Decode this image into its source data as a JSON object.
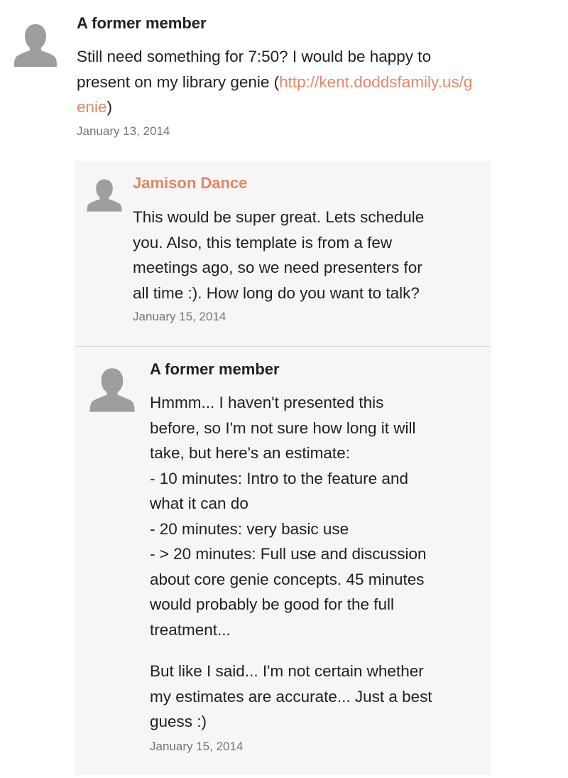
{
  "comments": [
    {
      "author": "A former member",
      "body_pre": "Still need something for 7:50? I would be happy to present on my library genie (",
      "link_text": "http://kent.doddsfamily.us/genie",
      "body_post": ")",
      "date": "January 13, 2014"
    },
    {
      "author": "Jamison Dance",
      "body_lines": [
        "This would be super great. Lets schedule",
        "you. Also, this template is from a few",
        "meetings ago, so we need presenters for",
        "all time :). How long do you want to talk?"
      ],
      "date": "January 15, 2014"
    },
    {
      "author": "A former member",
      "body_lines": [
        "Hmmm... I haven't presented this",
        "before, so I'm not sure how long it will",
        "take, but here's an estimate:",
        "- 10 minutes: Intro to the feature and",
        "what it can do",
        "- 20 minutes: very basic use",
        "- > 20 minutes: Full use and discussion",
        "about core genie concepts. 45 minutes",
        "would probably be good for the full",
        "treatment..."
      ],
      "body_lines_2": [
        "But like I said... I'm not certain whether",
        "my estimates are accurate... Just a best",
        "guess :)"
      ],
      "date": "January 15, 2014"
    }
  ],
  "icons": {
    "avatar": "default-user-silhouette-icon",
    "avatar_color": "#9e9e9e"
  },
  "colors": {
    "link": "#e08866",
    "reply_bg": "#f6f6f6",
    "date": "#757575"
  }
}
